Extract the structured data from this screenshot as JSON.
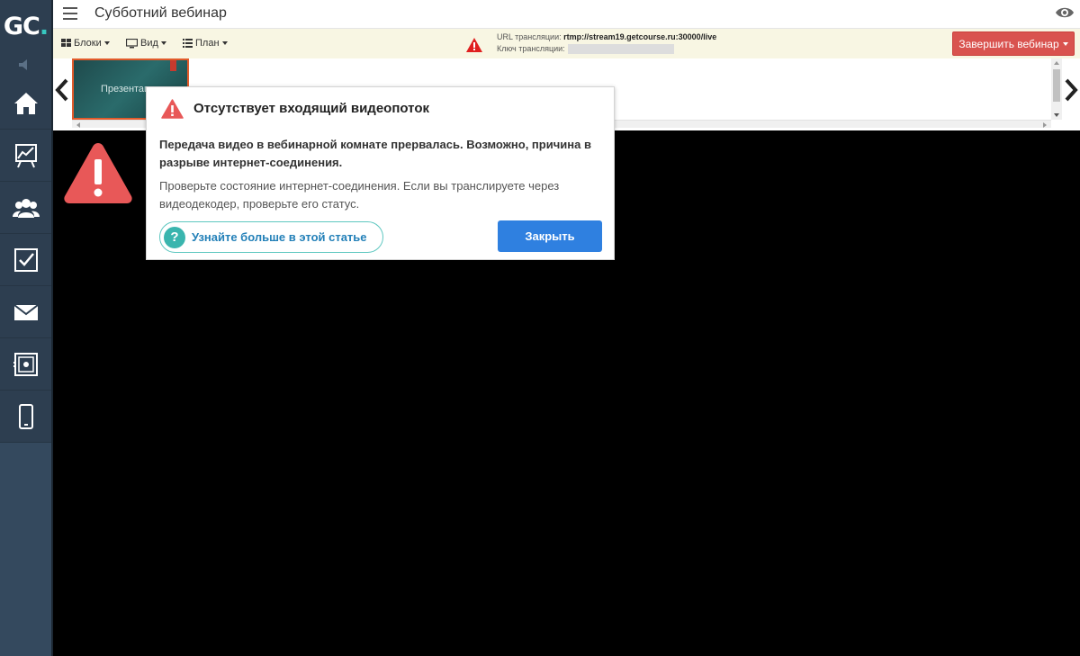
{
  "app": {
    "logo_text": "GC",
    "logo_dot": ".",
    "title": "Субботний вебинар"
  },
  "sidebar": {
    "items": [
      {
        "icon": "home-icon"
      },
      {
        "icon": "chart-icon"
      },
      {
        "icon": "users-icon"
      },
      {
        "icon": "checkbox-icon"
      },
      {
        "icon": "mail-icon"
      },
      {
        "icon": "safe-icon"
      },
      {
        "icon": "phone-icon"
      }
    ]
  },
  "toolbar": {
    "blocks_label": "Блоки",
    "view_label": "Вид",
    "plan_label": "План",
    "url_label": "URL трансляции:",
    "url_value": "rtmp://stream19.getcourse.ru:30000/live",
    "key_label": "Ключ трансляции:",
    "end_button_label": "Завершить вебинар"
  },
  "slides": {
    "thumb_title": "Презентац"
  },
  "modal": {
    "title": "Отсутствует входящий видеопоток",
    "bold_text": "Передача видео в вебинарной комнате прервалась. Возможно, причина в разрыве интернет-соединения.",
    "text": "Проверьте состояние интернет-соединения. Если вы транслируете через видеодекодер, проверьте его статус.",
    "learn_more_label": "Узнайте больше в этой статье",
    "close_label": "Закрыть"
  },
  "colors": {
    "sidebar_bg": "#2d3e50",
    "accent_red": "#d9534f",
    "warning_red": "#e85858",
    "primary_blue": "#2f80e0",
    "teal": "#3ab5ae",
    "toolbar_bg": "#f8f6e3"
  }
}
